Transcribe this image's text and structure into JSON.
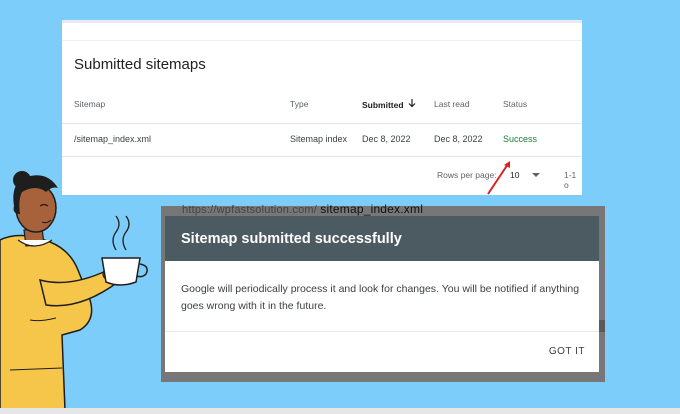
{
  "sitemaps_card": {
    "title": "Submitted sitemaps",
    "columns": {
      "sitemap": "Sitemap",
      "type": "Type",
      "submitted": "Submitted",
      "last_read": "Last read",
      "status": "Status"
    },
    "rows": [
      {
        "sitemap": "/sitemap_index.xml",
        "type": "Sitemap index",
        "submitted": "Dec 8, 2022",
        "last_read": "Dec 8, 2022",
        "status": "Success"
      }
    ],
    "footer": {
      "rows_per_page_label": "Rows per page:",
      "rows_per_page_value": "10",
      "range": "1-1 o"
    }
  },
  "behind_text": {
    "domain": "https://wpfastsolution.com/",
    "file": "sitemap_index.xml"
  },
  "dialog": {
    "title": "Sitemap submitted successfully",
    "message": "Google will periodically process it and look for changes. You will be notified if anything goes wrong with it in the future.",
    "button": "GOT IT"
  },
  "colors": {
    "background": "#7dcdfb",
    "success": "#188038",
    "dialog_header": "#4c5a61",
    "arrow": "#e02020"
  }
}
